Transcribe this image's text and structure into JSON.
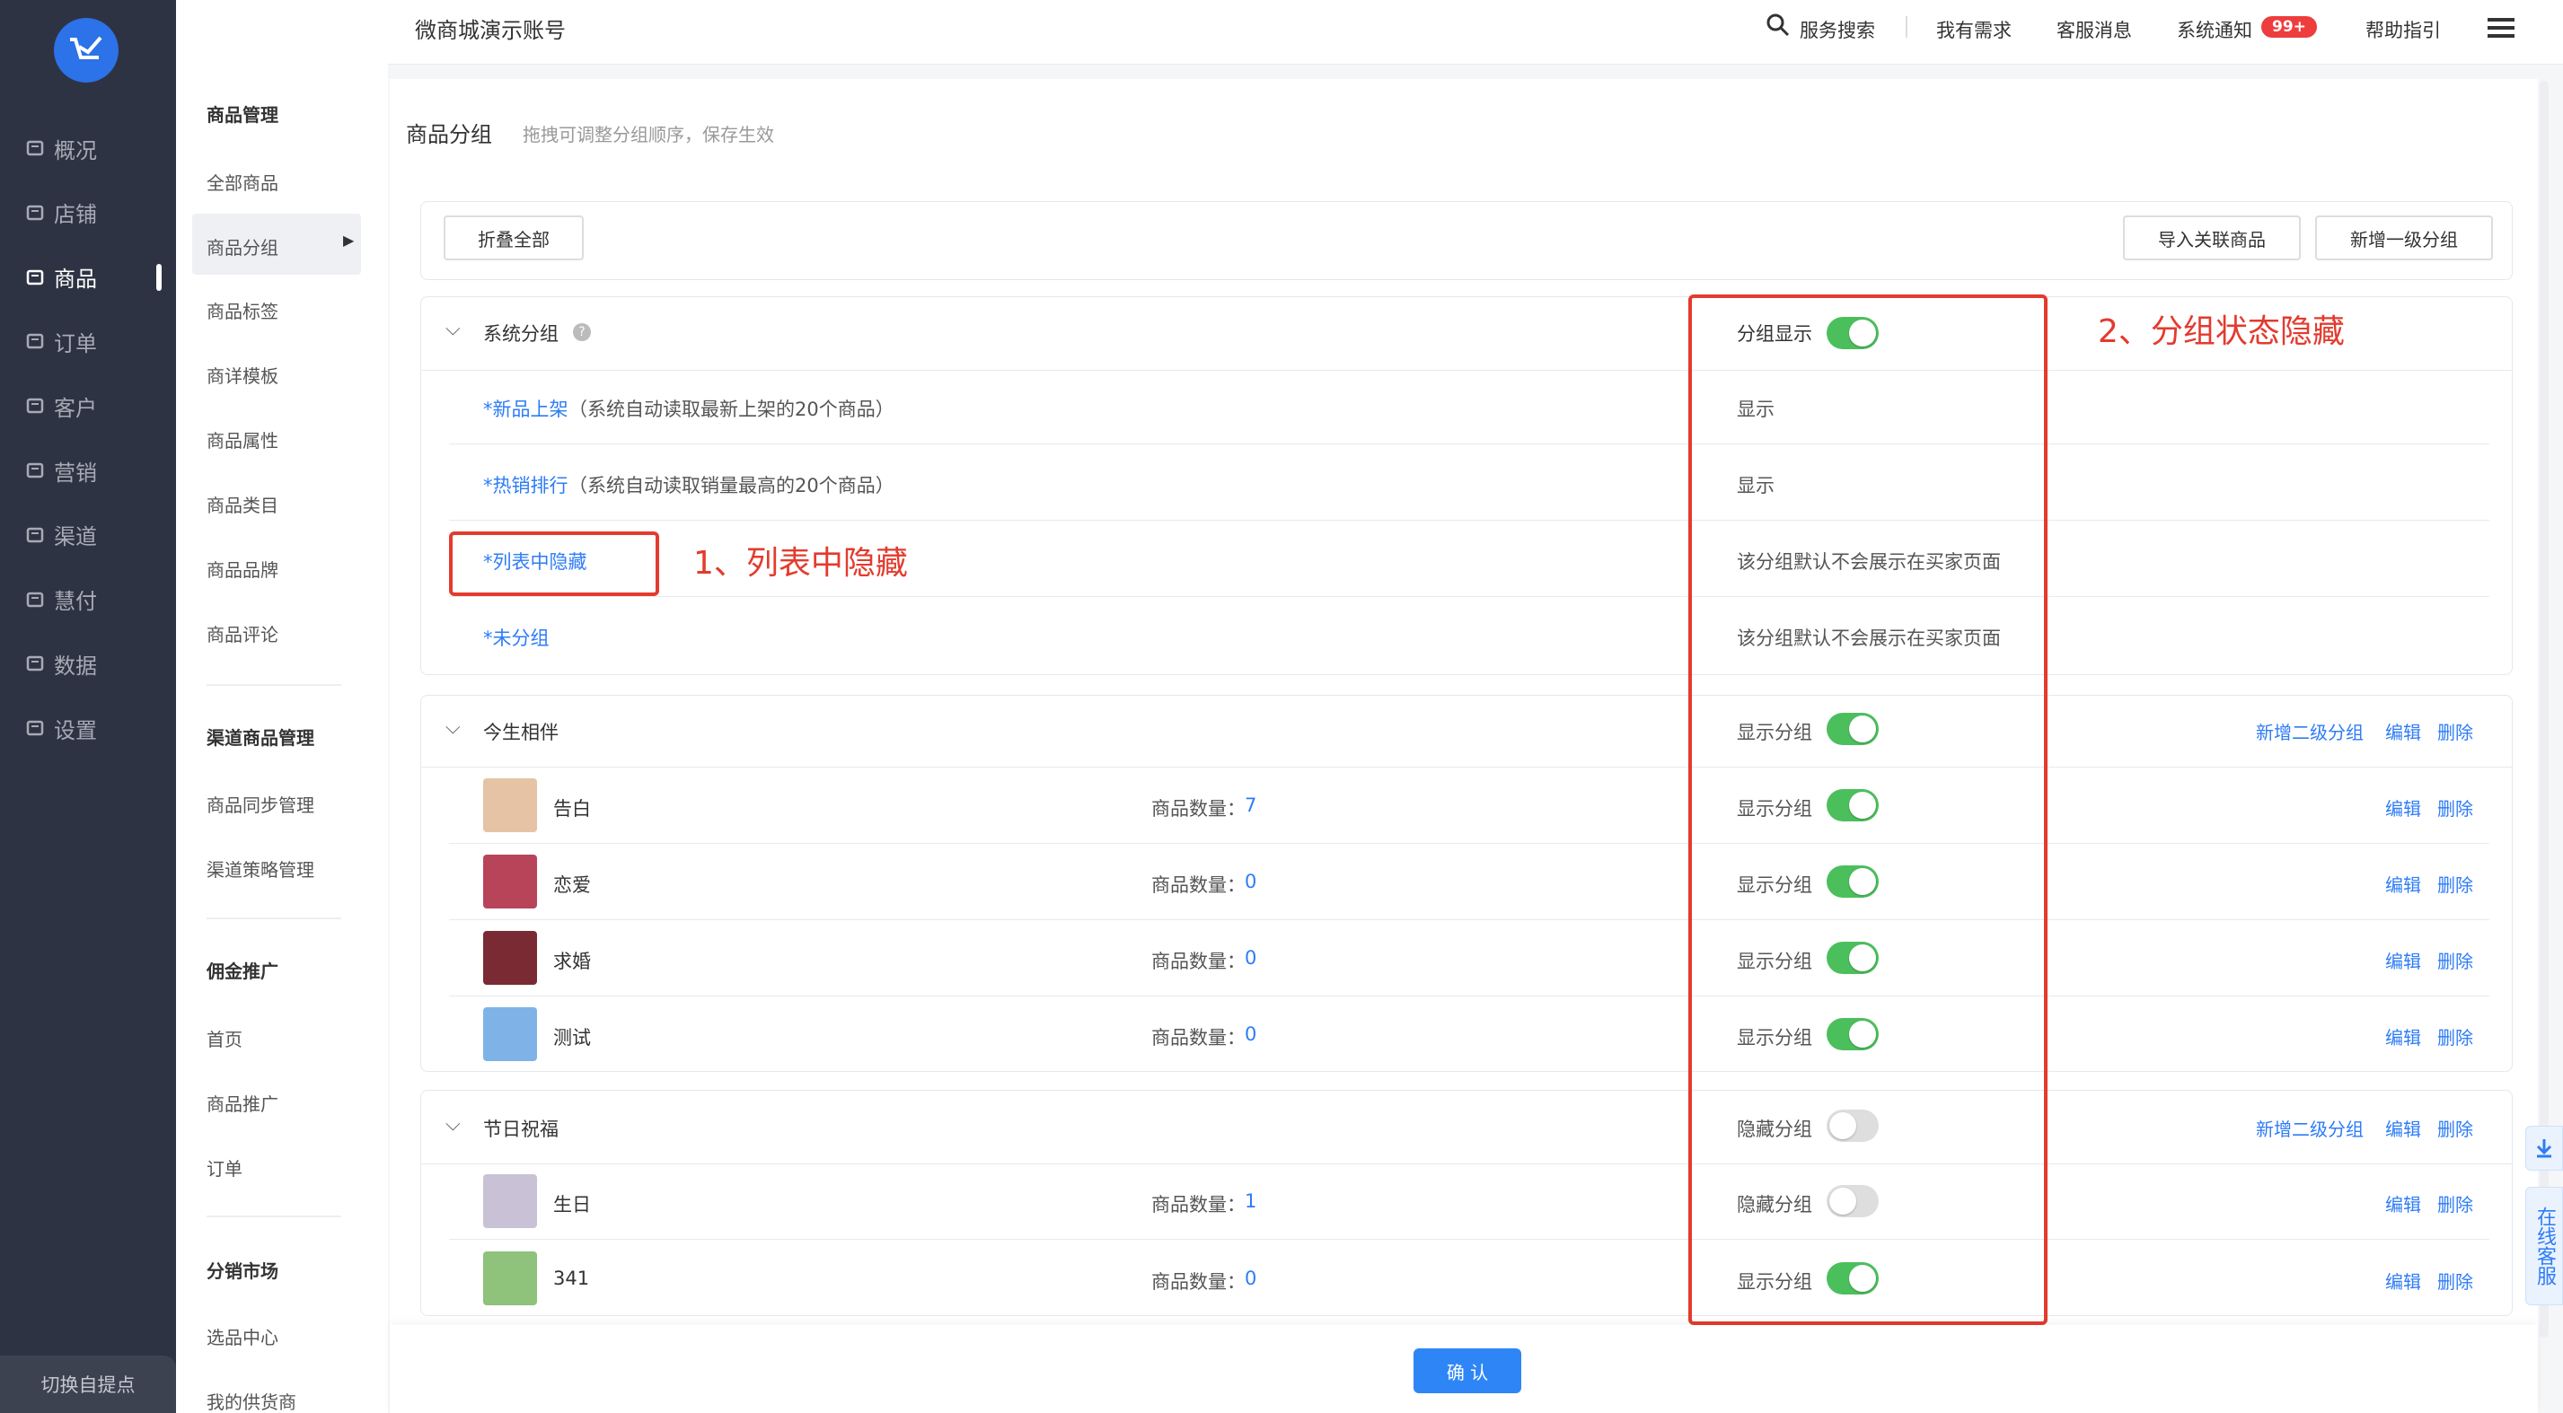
{
  "nav": {
    "items": [
      {
        "label": "概况",
        "icon": "overview-icon"
      },
      {
        "label": "店铺",
        "icon": "store-icon"
      },
      {
        "label": "商品",
        "icon": "goods-icon"
      },
      {
        "label": "订单",
        "icon": "order-icon"
      },
      {
        "label": "客户",
        "icon": "customer-icon"
      },
      {
        "label": "营销",
        "icon": "marketing-icon"
      },
      {
        "label": "渠道",
        "icon": "channel-icon"
      },
      {
        "label": "慧付",
        "icon": "pay-icon"
      },
      {
        "label": "数据",
        "icon": "data-icon"
      },
      {
        "label": "设置",
        "icon": "settings-icon"
      }
    ],
    "switch_label": "切换自提点"
  },
  "subnav": {
    "sec1_title": "商品管理",
    "sec1": [
      "全部商品",
      "商品分组",
      "商品标签",
      "商详模板",
      "商品属性",
      "商品类目",
      "商品品牌",
      "商品评论"
    ],
    "sec2_title": "渠道商品管理",
    "sec2": [
      "商品同步管理",
      "渠道策略管理"
    ],
    "sec3_title": "佣金推广",
    "sec3": [
      "首页",
      "商品推广",
      "订单"
    ],
    "sec4_title": "分销市场",
    "sec4": [
      "选品中心",
      "我的供货商"
    ]
  },
  "header": {
    "title": "微商城演示账号",
    "search": "服务搜索",
    "demand": "我有需求",
    "service": "客服消息",
    "notice": "系统通知",
    "badge": "99+",
    "help": "帮助指引"
  },
  "page": {
    "title": "商品分组",
    "hint": "拖拽可调整分组顺序，保存生效",
    "collapse_all": "折叠全部",
    "import_btn": "导入关联商品",
    "add_group_btn": "新增一级分组",
    "confirm": "确 认"
  },
  "system_group": {
    "name": "系统分组",
    "status_label": "分组显示",
    "rows": [
      {
        "name": "*新品上架",
        "desc": "（系统自动读取最新上架的20个商品）",
        "status": "显示"
      },
      {
        "name": "*热销排行",
        "desc": "（系统自动读取销量最高的20个商品）",
        "status": "显示"
      },
      {
        "name": "*列表中隐藏",
        "desc": "",
        "status": "该分组默认不会展示在买家页面"
      },
      {
        "name": "*未分组",
        "desc": "",
        "status": "该分组默认不会展示在买家页面"
      }
    ]
  },
  "groups": [
    {
      "name": "今生相伴",
      "status": "显示分组",
      "on": true,
      "add_sub": "新增二级分组",
      "edit": "编辑",
      "delete": "删除",
      "children": [
        {
          "name": "告白",
          "count_label": "商品数量：",
          "count": "7",
          "status": "显示分组",
          "on": true
        },
        {
          "name": "恋爱",
          "count_label": "商品数量：",
          "count": "0",
          "status": "显示分组",
          "on": true
        },
        {
          "name": "求婚",
          "count_label": "商品数量：",
          "count": "0",
          "status": "显示分组",
          "on": true
        },
        {
          "name": "测试",
          "count_label": "商品数量：",
          "count": "0",
          "status": "显示分组",
          "on": true
        }
      ]
    },
    {
      "name": "节日祝福",
      "status": "隐藏分组",
      "on": false,
      "add_sub": "新增二级分组",
      "edit": "编辑",
      "delete": "删除",
      "children": [
        {
          "name": "生日",
          "count_label": "商品数量：",
          "count": "1",
          "status": "隐藏分组",
          "on": false
        },
        {
          "name": "341",
          "count_label": "商品数量：",
          "count": "0",
          "status": "显示分组",
          "on": true
        }
      ]
    }
  ],
  "annotations": {
    "a1": "1、列表中隐藏",
    "a2": "2、分组状态隐藏"
  },
  "float": {
    "online": "在线客服"
  },
  "colors": {
    "accent": "#2e7cf6",
    "toggle_on": "#4cbf5d",
    "annotation": "#e33b2e",
    "nav_bg": "#2e3343"
  }
}
